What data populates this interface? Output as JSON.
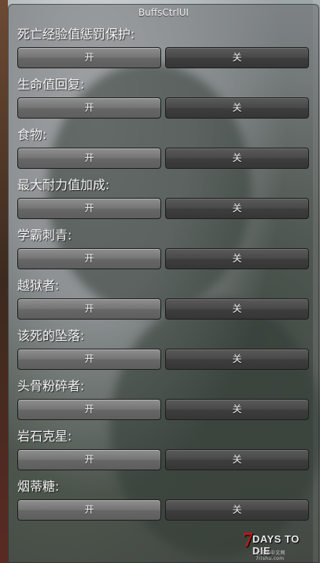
{
  "window": {
    "title": "BuffsCtrlUI"
  },
  "items": [
    {
      "label": "死亡经验值惩罚保护:",
      "on": "开",
      "off": "关"
    },
    {
      "label": "生命值回复:",
      "on": "开",
      "off": "关"
    },
    {
      "label": "食物:",
      "on": "开",
      "off": "关"
    },
    {
      "label": "最大耐力值加成:",
      "on": "开",
      "off": "关"
    },
    {
      "label": "学霸刺青:",
      "on": "开",
      "off": "关"
    },
    {
      "label": "越狱者:",
      "on": "开",
      "off": "关"
    },
    {
      "label": "该死的坠落:",
      "on": "开",
      "off": "关"
    },
    {
      "label": "头骨粉碎者:",
      "on": "开",
      "off": "关"
    },
    {
      "label": "岩石克星:",
      "on": "开",
      "off": "关"
    },
    {
      "label": "烟蒂糖:",
      "on": "开",
      "off": "关"
    }
  ],
  "logo": {
    "seven": "7",
    "text": "DAYS TO DIE",
    "sub": "七日杀中文网 7rishu.com"
  }
}
